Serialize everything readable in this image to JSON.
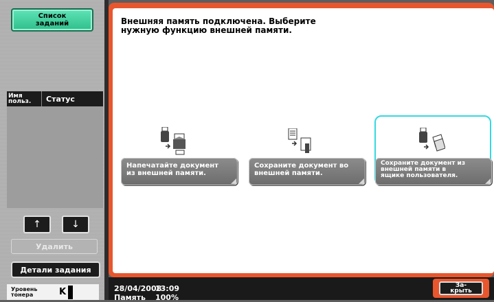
{
  "left_panel": {
    "job_list_button": "Список\nзаданий",
    "status_header": {
      "user_label": "Имя\nпольз.",
      "status_label": "Статус"
    },
    "arrow_up": "↑",
    "arrow_down": "↓",
    "delete_button": "Удалить",
    "job_details_button": "Детали задания",
    "toner": {
      "label": "Уровень\nтонера",
      "color_code": "K"
    }
  },
  "main": {
    "instruction": "Внешняя память подключена. Выберите\nнужную функцию внешней памяти.",
    "functions": [
      {
        "label": "Напечатайте документ\nиз внешней памяти.",
        "icon": "usb-print-icon",
        "selected": false
      },
      {
        "label": "Сохраните документ во\nвнешней памяти.",
        "icon": "document-to-usb-icon",
        "selected": false
      },
      {
        "label": "Сохраните документ из\nвнешней памяти в\nящике пользователя.",
        "icon": "usb-to-box-icon",
        "selected": true
      }
    ],
    "accent_color": "#e8562e",
    "selection_color": "#33d9e0"
  },
  "bottom_bar": {
    "date": "28/04/2008",
    "time": "13:09",
    "memory_label": "Память",
    "memory_value": "100%",
    "close_button": "За-\nкрыть"
  }
}
